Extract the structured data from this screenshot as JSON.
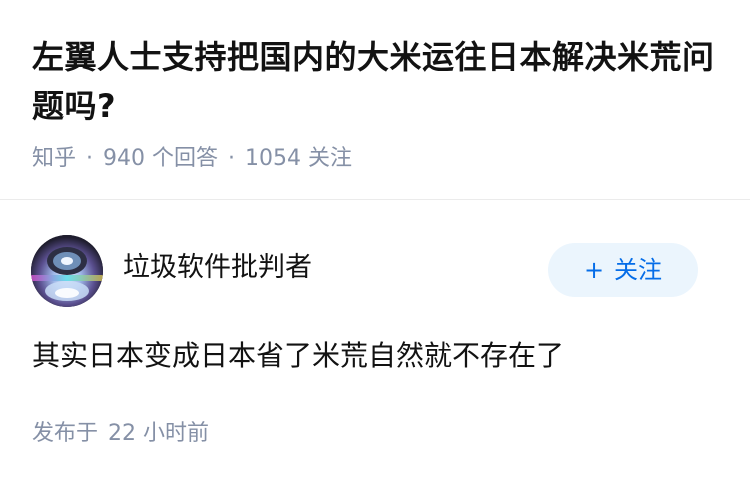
{
  "question": {
    "title": "左翼人士支持把国内的大米运往日本解决米荒问题吗?",
    "source": "知乎",
    "answer_count": "940",
    "answer_label": "个回答",
    "follow_count": "1054",
    "follow_label": "关注",
    "separator": "·"
  },
  "answer": {
    "author_name": "垃圾软件批判者",
    "follow_button_label": "关注",
    "follow_button_icon": "plus-icon",
    "content": "其实日本变成日本省了米荒自然就不存在了",
    "posted_label": "发布于",
    "posted_time": "22 小时前"
  },
  "colors": {
    "title": "#121212",
    "meta": "#8590a6",
    "follow_button_bg": "#ebf5fd",
    "follow_button_text": "#056de8",
    "divider": "#ebebeb"
  }
}
